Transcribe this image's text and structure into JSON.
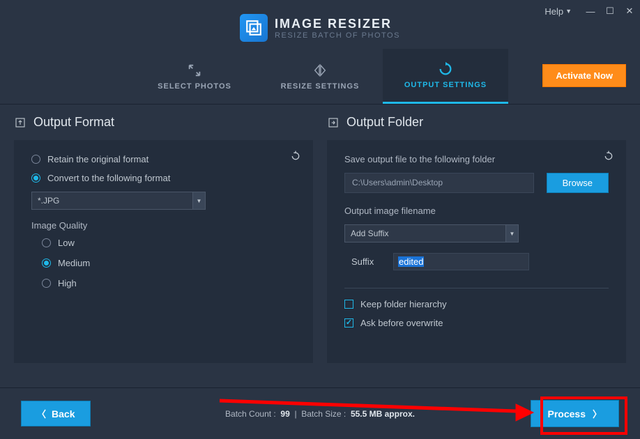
{
  "header": {
    "app_title": "IMAGE RESIZER",
    "app_subtitle": "RESIZE BATCH OF PHOTOS",
    "help_label": "Help"
  },
  "tabs": {
    "select_photos": "SELECT PHOTOS",
    "resize_settings": "RESIZE SETTINGS",
    "output_settings": "OUTPUT SETTINGS"
  },
  "activate_label": "Activate Now",
  "format_panel": {
    "title": "Output Format",
    "retain_label": "Retain the original format",
    "convert_label": "Convert to the following format",
    "format_value": "*.JPG",
    "quality_label": "Image Quality",
    "low": "Low",
    "medium": "Medium",
    "high": "High"
  },
  "folder_panel": {
    "title": "Output Folder",
    "save_label": "Save output file to the following folder",
    "path_value": "C:\\Users\\admin\\Desktop",
    "browse_label": "Browse",
    "filename_label": "Output image filename",
    "mode_value": "Add Suffix",
    "suffix_label": "Suffix",
    "suffix_value": "edited",
    "keep_hierarchy": "Keep folder hierarchy",
    "ask_overwrite": "Ask before overwrite"
  },
  "footer": {
    "back": "Back",
    "process": "Process",
    "batch_count_label": "Batch Count :",
    "batch_count": "99",
    "batch_size_label": "Batch Size :",
    "batch_size": "55.5 MB approx."
  }
}
